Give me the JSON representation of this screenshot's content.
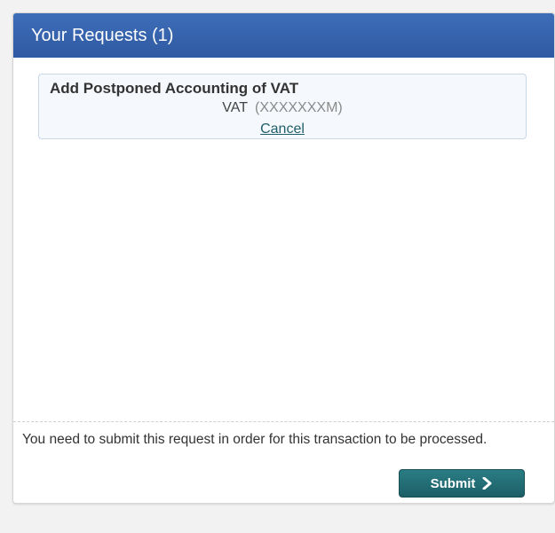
{
  "header": {
    "title": "Your Requests (1)"
  },
  "request": {
    "title": "Add Postponed Accounting of VAT",
    "type": "VAT",
    "reference": "(XXXXXXXM)",
    "cancel_label": "Cancel"
  },
  "footer": {
    "notice": "You need to submit this request in order for this transaction to be processed.",
    "submit_label": "Submit",
    "submit_icon": "chevron-right-icon"
  },
  "colors": {
    "header_bg": "#2f5aa2",
    "button_bg": "#1c5e66",
    "link": "#1f5f6b"
  }
}
